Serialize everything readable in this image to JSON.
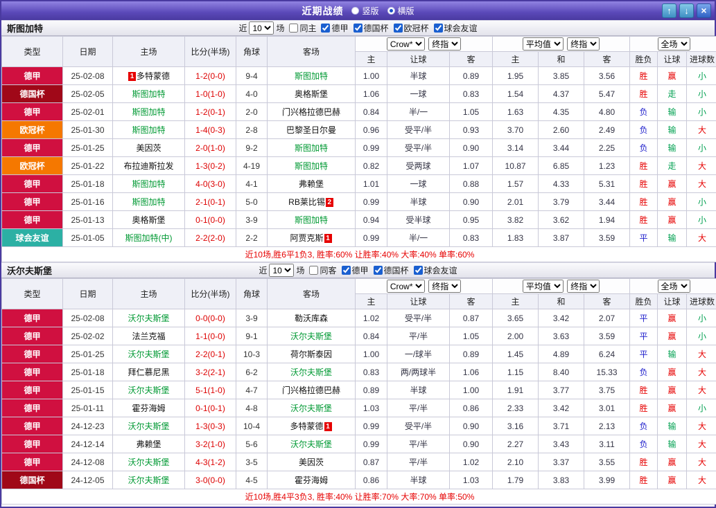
{
  "titlebar": {
    "title": "近期战绩",
    "modes": [
      {
        "label": "竖版",
        "selected": false
      },
      {
        "label": "横版",
        "selected": true
      }
    ],
    "up_icon": "↑",
    "down_icon": "↓",
    "close_icon": "×"
  },
  "header_labels": {
    "near": "近",
    "games": "场",
    "type": "类型",
    "date": "日期",
    "home": "主场",
    "score": "比分(半场)",
    "corner": "角球",
    "away": "客场",
    "odds_source": "Crow*",
    "final_index": "终指",
    "average": "平均值",
    "final_index2": "终指",
    "full_match": "全场",
    "sub_home": "主",
    "sub_handicap": "让球",
    "sub_away": "客",
    "sub_home2": "主",
    "sub_draw": "和",
    "sub_away2": "客",
    "result": "胜负",
    "handicap_result": "让球",
    "goals_total": "进球数"
  },
  "colors": {
    "league": {
      "德甲": "#d01040",
      "德国杯": "#a00818",
      "欧冠杯": "#f57800",
      "球会友谊": "#2cb0a4"
    },
    "outcome": {
      "胜": "#e60000",
      "平": "#2222cc",
      "负": "#2222cc",
      "赢": "#e60000",
      "走": "#00a050",
      "输": "#00a050",
      "大": "#e60000",
      "小": "#00a050"
    },
    "focus_team": "#009933",
    "score": "#dd0000",
    "summary": "#e60000"
  },
  "sections": [
    {
      "team": "斯图加特",
      "count": "10",
      "same_venue_label": "同主",
      "same_venue_checked": false,
      "leagues": [
        {
          "label": "德甲",
          "checked": true
        },
        {
          "label": "德国杯",
          "checked": true
        },
        {
          "label": "欧冠杯",
          "checked": true
        },
        {
          "label": "球会友谊",
          "checked": true
        }
      ],
      "rows": [
        {
          "league": "德甲",
          "date": "25-02-08",
          "home": "多特蒙德",
          "home_badge": "1",
          "home_badge_pos": "pre",
          "home_focus": false,
          "score": "1-2(0-0)",
          "corner": "9-4",
          "away": "斯图加特",
          "away_focus": true,
          "h_home": "1.00",
          "h_line": "半球",
          "h_away": "0.89",
          "e_home": "1.95",
          "e_draw": "3.85",
          "e_away": "3.56",
          "result": "胜",
          "h_result": "赢",
          "g_result": "小"
        },
        {
          "league": "德国杯",
          "date": "25-02-05",
          "home": "斯图加特",
          "home_focus": true,
          "score": "1-0(1-0)",
          "corner": "4-0",
          "away": "奥格斯堡",
          "away_focus": false,
          "h_home": "1.06",
          "h_line": "一球",
          "h_away": "0.83",
          "e_home": "1.54",
          "e_draw": "4.37",
          "e_away": "5.47",
          "result": "胜",
          "h_result": "走",
          "g_result": "小"
        },
        {
          "league": "德甲",
          "date": "25-02-01",
          "home": "斯图加特",
          "home_focus": true,
          "score": "1-2(0-1)",
          "corner": "2-0",
          "away": "门兴格拉德巴赫",
          "away_focus": false,
          "h_home": "0.84",
          "h_line": "半/一",
          "h_away": "1.05",
          "e_home": "1.63",
          "e_draw": "4.35",
          "e_away": "4.80",
          "result": "负",
          "h_result": "输",
          "g_result": "小"
        },
        {
          "league": "欧冠杯",
          "date": "25-01-30",
          "home": "斯图加特",
          "home_focus": true,
          "score": "1-4(0-3)",
          "corner": "2-8",
          "away": "巴黎圣日尔曼",
          "away_focus": false,
          "h_home": "0.96",
          "h_line": "受平/半",
          "h_away": "0.93",
          "e_home": "3.70",
          "e_draw": "2.60",
          "e_away": "2.49",
          "result": "负",
          "h_result": "输",
          "g_result": "大"
        },
        {
          "league": "德甲",
          "date": "25-01-25",
          "home": "美因茨",
          "home_focus": false,
          "score": "2-0(1-0)",
          "corner": "9-2",
          "away": "斯图加特",
          "away_focus": true,
          "h_home": "0.99",
          "h_line": "受平/半",
          "h_away": "0.90",
          "e_home": "3.14",
          "e_draw": "3.44",
          "e_away": "2.25",
          "result": "负",
          "h_result": "输",
          "g_result": "小"
        },
        {
          "league": "欧冠杯",
          "date": "25-01-22",
          "home": "布拉迪斯拉发",
          "home_focus": false,
          "score": "1-3(0-2)",
          "corner": "4-19",
          "away": "斯图加特",
          "away_focus": true,
          "h_home": "0.82",
          "h_line": "受两球",
          "h_away": "1.07",
          "e_home": "10.87",
          "e_draw": "6.85",
          "e_away": "1.23",
          "result": "胜",
          "h_result": "走",
          "g_result": "大"
        },
        {
          "league": "德甲",
          "date": "25-01-18",
          "home": "斯图加特",
          "home_focus": true,
          "score": "4-0(3-0)",
          "corner": "4-1",
          "away": "弗赖堡",
          "away_focus": false,
          "h_home": "1.01",
          "h_line": "一球",
          "h_away": "0.88",
          "e_home": "1.57",
          "e_draw": "4.33",
          "e_away": "5.31",
          "result": "胜",
          "h_result": "赢",
          "g_result": "大"
        },
        {
          "league": "德甲",
          "date": "25-01-16",
          "home": "斯图加特",
          "home_focus": true,
          "score": "2-1(0-1)",
          "corner": "5-0",
          "away": "RB莱比锡",
          "away_badge": "2",
          "away_badge_pos": "post",
          "away_focus": false,
          "h_home": "0.99",
          "h_line": "半球",
          "h_away": "0.90",
          "e_home": "2.01",
          "e_draw": "3.79",
          "e_away": "3.44",
          "result": "胜",
          "h_result": "赢",
          "g_result": "小"
        },
        {
          "league": "德甲",
          "date": "25-01-13",
          "home": "奥格斯堡",
          "home_focus": false,
          "score": "0-1(0-0)",
          "corner": "3-9",
          "away": "斯图加特",
          "away_focus": true,
          "h_home": "0.94",
          "h_line": "受半球",
          "h_away": "0.95",
          "e_home": "3.82",
          "e_draw": "3.62",
          "e_away": "1.94",
          "result": "胜",
          "h_result": "赢",
          "g_result": "小"
        },
        {
          "league": "球会友谊",
          "date": "25-01-05",
          "home": "斯图加特(中)",
          "home_focus": true,
          "score": "2-2(2-0)",
          "corner": "2-2",
          "away": "阿贾克斯",
          "away_badge": "1",
          "away_badge_pos": "post",
          "away_focus": false,
          "h_home": "0.99",
          "h_line": "半/一",
          "h_away": "0.83",
          "e_home": "1.83",
          "e_draw": "3.87",
          "e_away": "3.59",
          "result": "平",
          "h_result": "输",
          "g_result": "大"
        }
      ],
      "summary": "近10场,胜6平1负3, 胜率:60% 让胜率:40% 大率:40% 单率:60%"
    },
    {
      "team": "沃尔夫斯堡",
      "count": "10",
      "same_venue_label": "同客",
      "same_venue_checked": false,
      "leagues": [
        {
          "label": "德甲",
          "checked": true
        },
        {
          "label": "德国杯",
          "checked": true
        },
        {
          "label": "球会友谊",
          "checked": true
        }
      ],
      "rows": [
        {
          "league": "德甲",
          "date": "25-02-08",
          "home": "沃尔夫斯堡",
          "home_focus": true,
          "score": "0-0(0-0)",
          "corner": "3-9",
          "away": "勒沃库森",
          "away_focus": false,
          "h_home": "1.02",
          "h_line": "受平/半",
          "h_away": "0.87",
          "e_home": "3.65",
          "e_draw": "3.42",
          "e_away": "2.07",
          "result": "平",
          "h_result": "赢",
          "g_result": "小"
        },
        {
          "league": "德甲",
          "date": "25-02-02",
          "home": "法兰克福",
          "home_focus": false,
          "score": "1-1(0-0)",
          "corner": "9-1",
          "away": "沃尔夫斯堡",
          "away_focus": true,
          "h_home": "0.84",
          "h_line": "平/半",
          "h_away": "1.05",
          "e_home": "2.00",
          "e_draw": "3.63",
          "e_away": "3.59",
          "result": "平",
          "h_result": "赢",
          "g_result": "小"
        },
        {
          "league": "德甲",
          "date": "25-01-25",
          "home": "沃尔夫斯堡",
          "home_focus": true,
          "score": "2-2(0-1)",
          "corner": "10-3",
          "away": "荷尔斯泰因",
          "away_focus": false,
          "h_home": "1.00",
          "h_line": "一/球半",
          "h_away": "0.89",
          "e_home": "1.45",
          "e_draw": "4.89",
          "e_away": "6.24",
          "result": "平",
          "h_result": "输",
          "g_result": "大"
        },
        {
          "league": "德甲",
          "date": "25-01-18",
          "home": "拜仁慕尼黑",
          "home_focus": false,
          "score": "3-2(2-1)",
          "corner": "6-2",
          "away": "沃尔夫斯堡",
          "away_focus": true,
          "h_home": "0.83",
          "h_line": "两/两球半",
          "h_away": "1.06",
          "e_home": "1.15",
          "e_draw": "8.40",
          "e_away": "15.33",
          "result": "负",
          "h_result": "赢",
          "g_result": "大"
        },
        {
          "league": "德甲",
          "date": "25-01-15",
          "home": "沃尔夫斯堡",
          "home_focus": true,
          "score": "5-1(1-0)",
          "corner": "4-7",
          "away": "门兴格拉德巴赫",
          "away_focus": false,
          "h_home": "0.89",
          "h_line": "半球",
          "h_away": "1.00",
          "e_home": "1.91",
          "e_draw": "3.77",
          "e_away": "3.75",
          "result": "胜",
          "h_result": "赢",
          "g_result": "大"
        },
        {
          "league": "德甲",
          "date": "25-01-11",
          "home": "霍芬海姆",
          "home_focus": false,
          "score": "0-1(0-1)",
          "corner": "4-8",
          "away": "沃尔夫斯堡",
          "away_focus": true,
          "h_home": "1.03",
          "h_line": "平/半",
          "h_away": "0.86",
          "e_home": "2.33",
          "e_draw": "3.42",
          "e_away": "3.01",
          "result": "胜",
          "h_result": "赢",
          "g_result": "小"
        },
        {
          "league": "德甲",
          "date": "24-12-23",
          "home": "沃尔夫斯堡",
          "home_focus": true,
          "score": "1-3(0-3)",
          "corner": "10-4",
          "away": "多特蒙德",
          "away_badge": "1",
          "away_badge_pos": "post",
          "away_focus": false,
          "h_home": "0.99",
          "h_line": "受平/半",
          "h_away": "0.90",
          "e_home": "3.16",
          "e_draw": "3.71",
          "e_away": "2.13",
          "result": "负",
          "h_result": "输",
          "g_result": "大"
        },
        {
          "league": "德甲",
          "date": "24-12-14",
          "home": "弗赖堡",
          "home_focus": false,
          "score": "3-2(1-0)",
          "corner": "5-6",
          "away": "沃尔夫斯堡",
          "away_focus": true,
          "h_home": "0.99",
          "h_line": "平/半",
          "h_away": "0.90",
          "e_home": "2.27",
          "e_draw": "3.43",
          "e_away": "3.11",
          "result": "负",
          "h_result": "输",
          "g_result": "大"
        },
        {
          "league": "德甲",
          "date": "24-12-08",
          "home": "沃尔夫斯堡",
          "home_focus": true,
          "score": "4-3(1-2)",
          "corner": "3-5",
          "away": "美因茨",
          "away_focus": false,
          "h_home": "0.87",
          "h_line": "平/半",
          "h_away": "1.02",
          "e_home": "2.10",
          "e_draw": "3.37",
          "e_away": "3.55",
          "result": "胜",
          "h_result": "赢",
          "g_result": "大"
        },
        {
          "league": "德国杯",
          "date": "24-12-05",
          "home": "沃尔夫斯堡",
          "home_focus": true,
          "score": "3-0(0-0)",
          "corner": "4-5",
          "away": "霍芬海姆",
          "away_focus": false,
          "h_home": "0.86",
          "h_line": "半球",
          "h_away": "1.03",
          "e_home": "1.79",
          "e_draw": "3.83",
          "e_away": "3.99",
          "result": "胜",
          "h_result": "赢",
          "g_result": "大"
        }
      ],
      "summary": "近10场,胜4平3负3, 胜率:40% 让胜率:70% 大率:70% 单率:50%"
    }
  ]
}
